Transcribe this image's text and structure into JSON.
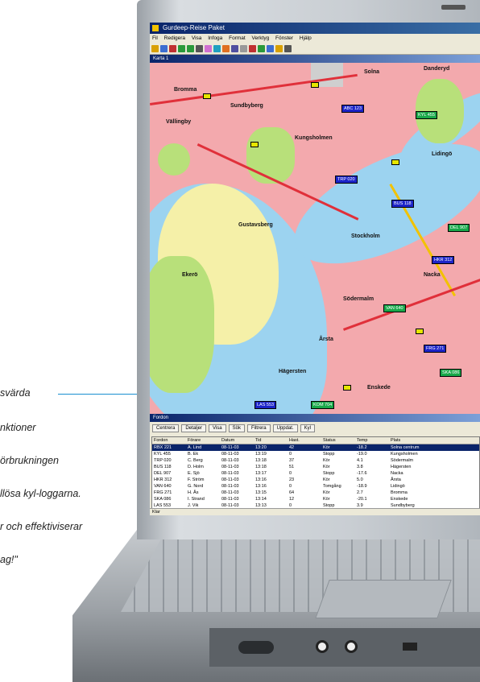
{
  "quote": {
    "lines": [
      "svärda",
      "nktioner",
      "örbrukningen",
      "llösa kyl-loggarna.",
      "r och effektiviserar",
      "ag!\""
    ]
  },
  "app": {
    "title": "Gurdeep-Reise Paket",
    "menu": [
      "Fil",
      "Redigera",
      "Visa",
      "Infoga",
      "Format",
      "Verktyg",
      "Fönster",
      "Hjälp"
    ],
    "map_window_title": "Karta 1",
    "map_labels": [
      "Solna",
      "Stockholm",
      "Danderyd",
      "Gustavsberg",
      "Bromma",
      "Årsta",
      "Kungsholmen",
      "Södermalm",
      "Hägersten",
      "Enskede",
      "Nacka",
      "Lidingö",
      "Ekerö",
      "Sundbyberg",
      "Vällingby"
    ],
    "vehicle_labels": [
      "ABC 123",
      "KYL 455",
      "TRP 020",
      "BUS 118",
      "DEL 907",
      "HKR 312",
      "VAN 640",
      "FRG 271",
      "SKA 086",
      "LAS 553",
      "KOM 704"
    ],
    "list_window_title": "Fordon",
    "list_buttons": [
      "Centrera",
      "Detaljer",
      "Visa",
      "Sök",
      "Filtrera",
      "Uppdat.",
      "Kyl"
    ],
    "table_headers": [
      "Fordon",
      "Förare",
      "Datum",
      "Tid",
      "Hast.",
      "Status",
      "Temp",
      "Plats"
    ],
    "table_rows": [
      [
        "RBX 221",
        "A. Lind",
        "08-11-03",
        "13:20",
        "42",
        "Kör",
        "-18.2",
        "Solna centrum"
      ],
      [
        "KYL 455",
        "B. Ek",
        "08-11-03",
        "13:19",
        "0",
        "Stopp",
        "-19.0",
        "Kungsholmen"
      ],
      [
        "TRP 020",
        "C. Berg",
        "08-11-03",
        "13:18",
        "37",
        "Kör",
        "4.1",
        "Södermalm"
      ],
      [
        "BUS 118",
        "D. Holm",
        "08-11-03",
        "13:18",
        "51",
        "Kör",
        "3.8",
        "Hägersten"
      ],
      [
        "DEL 907",
        "E. Sjö",
        "08-11-03",
        "13:17",
        "0",
        "Stopp",
        "-17.6",
        "Nacka"
      ],
      [
        "HKR 312",
        "F. Ström",
        "08-11-03",
        "13:16",
        "23",
        "Kör",
        "5.0",
        "Årsta"
      ],
      [
        "VAN 640",
        "G. Nord",
        "08-11-03",
        "13:16",
        "0",
        "Tomgång",
        "-18.9",
        "Lidingö"
      ],
      [
        "FRG 271",
        "H. Ås",
        "08-11-03",
        "13:15",
        "64",
        "Kör",
        "2.7",
        "Bromma"
      ],
      [
        "SKA 086",
        "I. Strand",
        "08-11-03",
        "13:14",
        "12",
        "Kör",
        "-20.1",
        "Enskede"
      ],
      [
        "LAS 553",
        "J. Vik",
        "08-11-03",
        "13:13",
        "0",
        "Stopp",
        "3.9",
        "Sundbyberg"
      ]
    ],
    "status_text": "Klar"
  },
  "colors": {
    "land": "#f3a9ad",
    "water": "#9cd3f0",
    "park": "#b8e07a",
    "sand": "#f5f0a8",
    "road": "#e0303a",
    "label_blue": "#1c24c8",
    "label_green": "#19a84a"
  }
}
